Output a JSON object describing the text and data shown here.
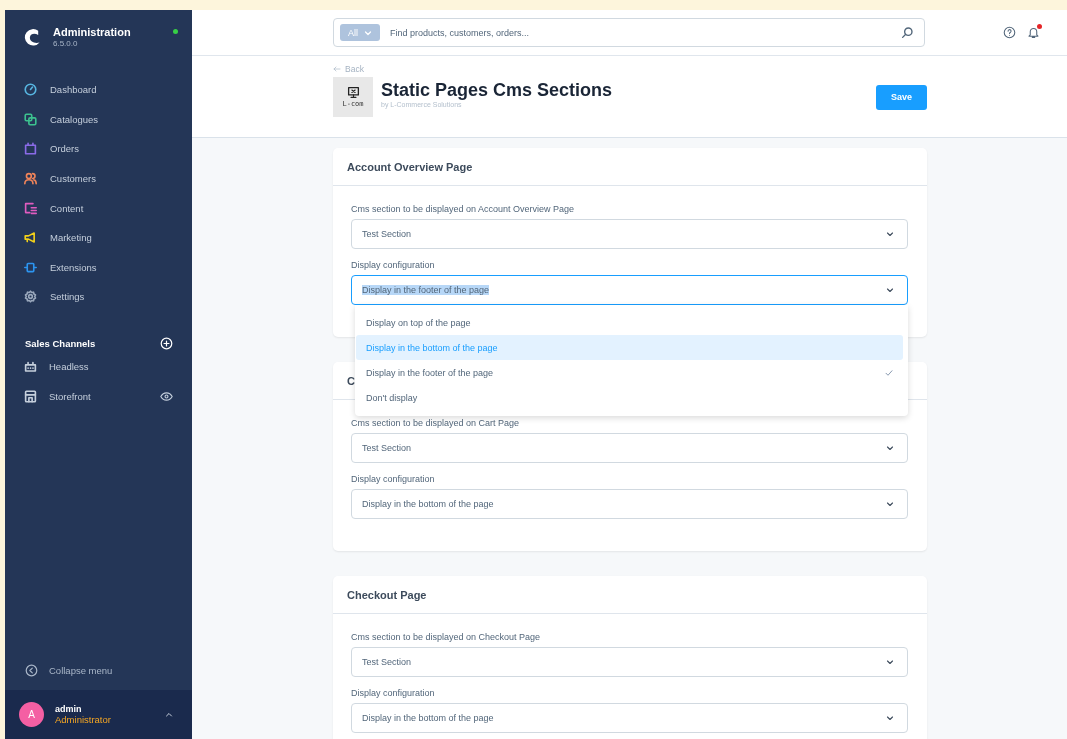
{
  "app": {
    "title": "Administration",
    "version": "6.5.0.0",
    "online": true
  },
  "nav": [
    {
      "label": "Dashboard",
      "kind": "dashboard",
      "color": "#57b5e0"
    },
    {
      "label": "Catalogues",
      "kind": "catalogues",
      "color": "#3cc28f"
    },
    {
      "label": "Orders",
      "kind": "orders",
      "color": "#8a6be8"
    },
    {
      "label": "Customers",
      "kind": "customers",
      "color": "#f0845a"
    },
    {
      "label": "Content",
      "kind": "content",
      "color": "#e05cc0"
    },
    {
      "label": "Marketing",
      "kind": "marketing",
      "color": "#f2d01a"
    },
    {
      "label": "Extensions",
      "kind": "extensions",
      "color": "#2c95f0"
    },
    {
      "label": "Settings",
      "kind": "settings",
      "color": "#9aa8bc"
    }
  ],
  "sales_channels": {
    "title": "Sales Channels",
    "items": [
      {
        "label": "Headless",
        "kind": "headless"
      },
      {
        "label": "Storefront",
        "kind": "storefront"
      }
    ]
  },
  "collapse": "Collapse menu",
  "user": {
    "initial": "A",
    "name": "admin",
    "role": "Administrator"
  },
  "search": {
    "scope": "All",
    "placeholder": "Find products, customers, orders..."
  },
  "notifications": {
    "unread": true
  },
  "back": "Back",
  "extension": {
    "logo_text": "L-com",
    "title": "Static Pages Cms Sections",
    "vendor": "by L-Commerce Solutions"
  },
  "save": "Save",
  "cards": [
    {
      "title": "Account Overview Page",
      "fields": [
        {
          "label": "Cms section to be displayed on Account Overview Page",
          "value": "Test Section",
          "focused": false
        },
        {
          "label": "Display configuration",
          "value": "Display in the footer of the page",
          "focused": true,
          "open": true,
          "options": [
            {
              "label": "Display on top of the page",
              "hovered": false,
              "selected": false
            },
            {
              "label": "Display in the bottom of the page",
              "hovered": true,
              "selected": false
            },
            {
              "label": "Display in the footer of the page",
              "hovered": false,
              "selected": true
            },
            {
              "label": "Don't display",
              "hovered": false,
              "selected": false
            }
          ]
        }
      ]
    },
    {
      "title": "C",
      "fields": [
        {
          "label": "Cms section to be displayed on Cart Page",
          "value": "Test Section",
          "focused": false
        },
        {
          "label": "Display configuration",
          "value": "Display in the bottom of the page",
          "focused": false
        }
      ]
    },
    {
      "title": "Checkout Page",
      "fields": [
        {
          "label": "Cms section to be displayed on Checkout Page",
          "value": "Test Section",
          "focused": false
        },
        {
          "label": "Display configuration",
          "value": "Display in the bottom of the page",
          "focused": false
        }
      ]
    }
  ]
}
